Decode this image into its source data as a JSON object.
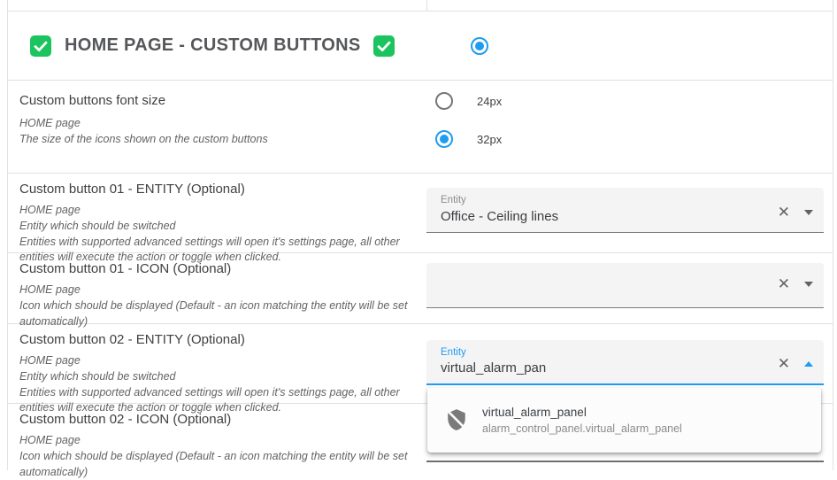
{
  "colors": {
    "accent_blue": "#1e9cf0",
    "accent_green": "#1cc45f"
  },
  "icons": {
    "clear": "✕",
    "checkbox_check": "check-icon",
    "dropdown_item": "shield-off-icon"
  },
  "header": {
    "title": "HOME PAGE - CUSTOM BUTTONS",
    "checkbox_left_checked": true,
    "checkbox_right_checked": true,
    "radio_selected": true
  },
  "font_size_setting": {
    "title": "Custom buttons font size",
    "subtitle": "HOME page",
    "description": "The size of the icons shown on the custom buttons",
    "options": [
      {
        "label": "24px",
        "selected": false
      },
      {
        "label": "32px",
        "selected": true
      }
    ]
  },
  "button01_entity": {
    "title": "Custom button 01 - ENTITY (Optional)",
    "subtitle": "HOME page",
    "description1": "Entity which should be switched",
    "description2": "Entities with supported advanced settings will open it's settings page, all other entities will execute the action or toggle when clicked.",
    "field_label": "Entity",
    "field_value": "Office - Ceiling lines"
  },
  "button01_icon": {
    "title": "Custom button 01 - ICON (Optional)",
    "subtitle": "HOME page",
    "description": "Icon which should be displayed (Default - an icon matching the entity will be set automatically)",
    "field_value": ""
  },
  "button02_entity": {
    "title": "Custom button 02 - ENTITY (Optional)",
    "subtitle": "HOME page",
    "description1": "Entity which should be switched",
    "description2": "Entities with supported advanced settings will open it's settings page, all other entities will execute the action or toggle when clicked.",
    "field_label": "Entity",
    "field_value": "virtual_alarm_pan",
    "dropdown_items": [
      {
        "icon": "shield-off-icon",
        "primary": "virtual_alarm_panel",
        "secondary": "alarm_control_panel.virtual_alarm_panel"
      }
    ]
  },
  "button02_icon": {
    "title": "Custom button 02 - ICON (Optional)",
    "subtitle": "HOME page",
    "description": "Icon which should be displayed (Default - an icon matching the entity will be set automatically)"
  }
}
